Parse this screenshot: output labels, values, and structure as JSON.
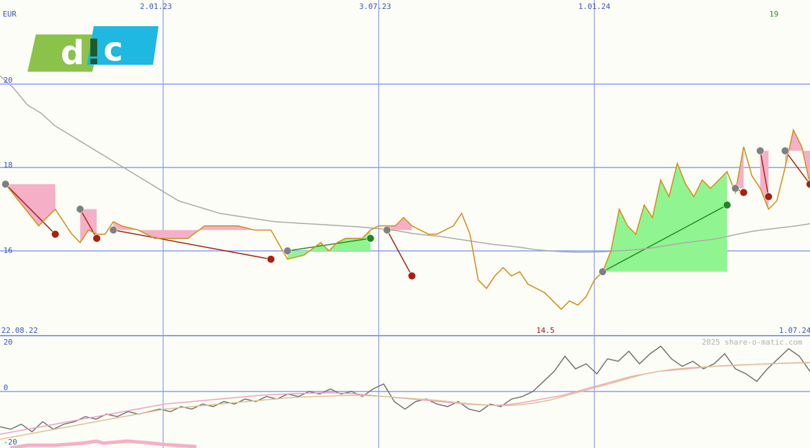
{
  "currency": "EUR",
  "last_price_label": "19",
  "min_price_label": "14.5",
  "date_start": "22.08.22",
  "date_end": "1.07.24",
  "watermark": "2025 share-o-matic.com",
  "colors": {
    "grid": "#8a9cf0",
    "price_line": "#d4901a",
    "moving_average": "#a9a9a9",
    "gain_fill": "#90f590",
    "loss_fill": "#f5b0c8",
    "sell_marker": "#a82010",
    "buy_marker": "#1e8a1e",
    "neutral_marker": "#808080",
    "indicator_line": "#707070",
    "indicator_signal_pink": "#f0a0c0",
    "indicator_signal_tan": "#e0c090",
    "logo_green": "#8bc34a",
    "logo_blue": "#1eb8e0"
  },
  "chart_data": [
    {
      "type": "line",
      "title": "",
      "y_unit": "EUR",
      "x_start": "22.08.22",
      "x_end": "1.07.24",
      "x_tick_labels": [
        "2.01.23",
        "3.07.23",
        "1.01.24"
      ],
      "y_tick_labels": [
        "16",
        "18",
        "20"
      ],
      "ylim": [
        14.0,
        21.8
      ],
      "grid": true,
      "x": [
        "22.08.22",
        "5.09.22",
        "19.09.22",
        "3.10.22",
        "17.10.22",
        "24.10.22",
        "31.10.22",
        "7.11.22",
        "14.11.22",
        "21.11.22",
        "28.11.22",
        "12.12.22",
        "26.12.22",
        "9.01.23",
        "23.01.23",
        "6.02.23",
        "20.02.23",
        "6.03.23",
        "20.03.23",
        "3.04.23",
        "17.04.23",
        "1.05.23",
        "15.05.23",
        "22.05.23",
        "29.05.23",
        "5.06.23",
        "12.06.23",
        "19.06.23",
        "26.06.23",
        "3.07.23",
        "10.07.23",
        "17.07.23",
        "24.07.23",
        "31.07.23",
        "7.08.23",
        "14.08.23",
        "21.08.23",
        "28.08.23",
        "4.09.23",
        "11.09.23",
        "18.09.23",
        "25.09.23",
        "2.10.23",
        "9.10.23",
        "16.10.23",
        "23.10.23",
        "30.10.23",
        "6.11.23",
        "13.11.23",
        "20.11.23",
        "27.11.23",
        "4.12.23",
        "11.12.23",
        "18.12.23",
        "25.12.23",
        "1.01.24",
        "8.01.24",
        "15.01.24",
        "22.01.24",
        "29.01.24",
        "5.02.24",
        "12.02.24",
        "19.02.24",
        "26.02.24",
        "4.03.24",
        "11.03.24",
        "18.03.24",
        "25.03.24",
        "1.04.24",
        "8.04.24",
        "15.04.24",
        "22.04.24",
        "29.04.24",
        "6.05.24",
        "13.05.24",
        "20.05.24",
        "27.05.24",
        "3.06.24",
        "10.06.24",
        "17.06.24",
        "24.06.24",
        "1.07.24"
      ],
      "series": [
        {
          "values": [
            17.6,
            17.1,
            16.6,
            17.0,
            16.4,
            16.2,
            16.5,
            16.4,
            16.4,
            16.7,
            16.6,
            16.5,
            16.3,
            16.3,
            16.3,
            16.6,
            16.6,
            16.6,
            16.5,
            16.5,
            15.8,
            15.9,
            16.2,
            16.0,
            16.2,
            16.3,
            16.3,
            16.3,
            16.5,
            16.6,
            16.6,
            16.6,
            16.8,
            16.6,
            16.5,
            16.4,
            16.4,
            16.5,
            16.6,
            16.9,
            16.4,
            15.3,
            15.1,
            15.4,
            15.6,
            15.4,
            15.5,
            15.2,
            15.1,
            15.0,
            14.8,
            14.6,
            14.8,
            14.7,
            14.9,
            15.3,
            15.5,
            16.0,
            17.0,
            16.6,
            16.4,
            17.1,
            16.8,
            17.7,
            17.3,
            18.1,
            17.6,
            17.3,
            17.7,
            17.5,
            17.7,
            17.9,
            17.4,
            18.5,
            17.8,
            17.5,
            17.0,
            17.2,
            18.0,
            18.9,
            18.5,
            17.6
          ],
          "name": ""
        },
        {
          "values": [
            20.2,
            19.9,
            19.5,
            19.3,
            19.0,
            18.8,
            18.6,
            18.4,
            18.2,
            18.0,
            17.8,
            17.6,
            17.4,
            17.2,
            17.1,
            17.0,
            16.9,
            16.85,
            16.8,
            16.75,
            16.7,
            16.68,
            16.66,
            16.64,
            16.62,
            16.6,
            16.58,
            16.55,
            16.52,
            16.48,
            16.42,
            16.38,
            16.35,
            16.3,
            16.25,
            16.2,
            16.15,
            16.12,
            16.08,
            16.03,
            16.0,
            15.98,
            15.97,
            15.97,
            15.98,
            16.0,
            16.02,
            16.05,
            16.1,
            16.15,
            16.2,
            16.24,
            16.28,
            16.35,
            16.42,
            16.48,
            16.52,
            16.56,
            16.6,
            16.65
          ],
          "name": ""
        }
      ],
      "signals": [
        {
          "date": "22.08.22",
          "kind": "neutral",
          "price": 17.6
        },
        {
          "date": "3.10.22",
          "kind": "sell",
          "price": 16.4
        },
        {
          "date": "24.10.22",
          "kind": "neutral",
          "price": 17.0
        },
        {
          "date": "7.11.22",
          "kind": "sell",
          "price": 16.3
        },
        {
          "date": "21.11.22",
          "kind": "neutral",
          "price": 16.5
        },
        {
          "date": "3.04.23",
          "kind": "sell",
          "price": 15.8
        },
        {
          "date": "17.04.23",
          "kind": "neutral",
          "price": 16.0
        },
        {
          "date": "26.06.23",
          "kind": "buy",
          "price": 16.3
        },
        {
          "date": "10.07.23",
          "kind": "neutral",
          "price": 16.5
        },
        {
          "date": "31.07.23",
          "kind": "sell",
          "price": 15.4
        },
        {
          "date": "8.01.24",
          "kind": "neutral",
          "price": 15.5
        },
        {
          "date": "22.04.24",
          "kind": "buy",
          "price": 17.1
        },
        {
          "date": "29.04.24",
          "kind": "neutral",
          "price": 17.5
        },
        {
          "date": "6.05.24",
          "kind": "sell",
          "price": 17.4
        },
        {
          "date": "20.05.24",
          "kind": "neutral",
          "price": 18.4
        },
        {
          "date": "27.05.24",
          "kind": "sell",
          "price": 17.3
        },
        {
          "date": "10.06.24",
          "kind": "neutral",
          "price": 18.4
        },
        {
          "date": "1.07.24",
          "kind": "sell",
          "price": 17.6
        }
      ]
    },
    {
      "type": "line",
      "title": "",
      "y_tick_labels": [
        "20",
        "0",
        "-20"
      ],
      "ylim": [
        -22,
        22
      ],
      "grid": true,
      "series": [
        {
          "values": [
            -14,
            -15,
            -13,
            -16,
            -12,
            -15,
            -13,
            -12,
            -10,
            -11,
            -9,
            -10,
            -8,
            -9,
            -8,
            -7,
            -8,
            -6,
            -7,
            -5,
            -6,
            -4,
            -5,
            -3,
            -4,
            -2,
            -3,
            -1,
            -2,
            0,
            -1,
            1,
            -1,
            0,
            -2,
            1,
            3,
            -4,
            -7,
            -4,
            -3,
            -5,
            -6,
            -4,
            -7,
            -8,
            -5,
            -6,
            -3,
            -2,
            0,
            4,
            8,
            14,
            9,
            11,
            7,
            13,
            12,
            16,
            11,
            15,
            18,
            13,
            10,
            12,
            9,
            11,
            15,
            9,
            7,
            4,
            9,
            13,
            17,
            14,
            8
          ],
          "name": ""
        },
        {
          "values": [
            -17,
            -16,
            -15,
            -14,
            -13,
            -12,
            -11,
            -10,
            -9,
            -8,
            -7,
            -6,
            -5,
            -4.5,
            -4,
            -3.5,
            -3,
            -2.5,
            -2,
            -1.5,
            -1.2,
            -1,
            -0.8,
            -0.6,
            -0.5,
            -0.7,
            -1,
            -1.5,
            -2,
            -2.5,
            -3,
            -3.5,
            -4,
            -4.5,
            -5,
            -5.3,
            -5.5,
            -5.2,
            -4.5,
            -3.5,
            -2.5,
            -1.5,
            0,
            1.5,
            3,
            4.5,
            6,
            7,
            8,
            8.5,
            9,
            9.5,
            10,
            10.2,
            10.5,
            10.8,
            11,
            11.2,
            11.4,
            11.5
          ],
          "name": ""
        },
        {
          "values": [
            -19,
            -18,
            -17,
            -16,
            -15,
            -14,
            -13,
            -12,
            -11,
            -10,
            -9,
            -8,
            -7,
            -6.5,
            -6,
            -5.5,
            -5,
            -4.5,
            -4,
            -3.5,
            -3,
            -2.5,
            -2.2,
            -2,
            -1.8,
            -1.6,
            -1.5,
            -1.7,
            -2,
            -2.4,
            -2.8,
            -3.2,
            -3.6,
            -4.2,
            -4.8,
            -5.2,
            -5.5,
            -5.6,
            -5.2,
            -4.5,
            -3.5,
            -2,
            -0.5,
            1,
            2.5,
            4,
            5.5,
            7,
            8,
            8.8,
            9.3,
            9.7,
            10,
            10.3,
            10.6,
            10.8,
            11,
            11.2,
            11.3,
            11.4
          ],
          "name": ""
        }
      ]
    }
  ]
}
